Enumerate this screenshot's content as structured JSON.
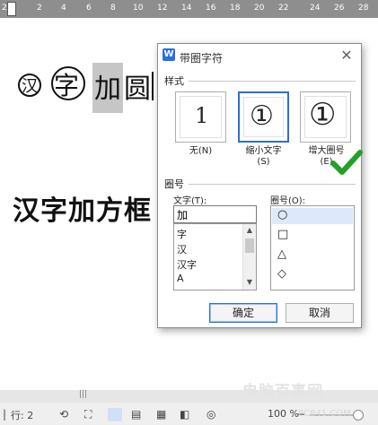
{
  "ruler": {
    "numbers": [
      "2",
      "2",
      "4",
      "6",
      "8",
      "10",
      "12",
      "14",
      "16",
      "18",
      "20",
      "22",
      "24",
      "26",
      "28"
    ]
  },
  "document": {
    "line1": {
      "circled_small": "汉",
      "circled_big": "字",
      "highlight_text": "加",
      "rest_text": "圆"
    },
    "line2": {
      "text": "汉字加方框"
    }
  },
  "dialog": {
    "title": "带圈字符",
    "close_icon": "close-icon",
    "style_section": "样式",
    "style_options": [
      {
        "label": "无(N)",
        "glyph": "1",
        "selected": false
      },
      {
        "label": "缩小文字\n(S)",
        "glyph": "①",
        "selected": true
      },
      {
        "label": "增大圈号\n(E)",
        "glyph": "①",
        "selected": false
      }
    ],
    "enclosure_section": "圈号",
    "text_label": "文字(T):",
    "text_value": "加",
    "text_list": [
      "字",
      "汉",
      "汉字",
      "A"
    ],
    "shape_label": "圈号(O):",
    "shape_list": [
      "○",
      "□",
      "△",
      "◇"
    ],
    "ok_label": "确定",
    "cancel_label": "取消"
  },
  "checkmark": {
    "color": "#22a02a"
  },
  "statusbar": {
    "row_text": "行: 2",
    "zoom": "100 %",
    "split_marker": "|||"
  },
  "watermark": {
    "text": "电脑百事网",
    "sub": "PC841.COM"
  }
}
